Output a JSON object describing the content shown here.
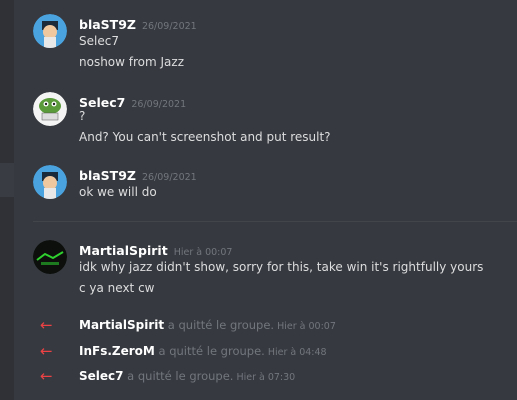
{
  "messages": [
    {
      "author": "blaST9Z",
      "timestamp": "26/09/2021",
      "lines": [
        "Selec7",
        "noshow from Jazz"
      ]
    },
    {
      "author": "Selec7",
      "timestamp": "26/09/2021",
      "lines": [
        "?",
        "And? You can't screenshot and put result?"
      ]
    },
    {
      "author": "blaST9Z",
      "timestamp": "26/09/2021",
      "lines": [
        "ok we will do"
      ]
    },
    {
      "author": "MartialSpirit",
      "timestamp": "Hier à 00:07",
      "lines": [
        "idk why jazz didn't show, sorry for this, take win it's rightfully yours",
        "c ya next cw"
      ]
    }
  ],
  "system": [
    {
      "user": "MartialSpirit",
      "action": "a quitté le groupe.",
      "time": "Hier à 00:07"
    },
    {
      "user": "InFs.ZeroM",
      "action": "a quitté le groupe.",
      "time": "Hier à 04:48"
    },
    {
      "user": "Selec7",
      "action": "a quitté le groupe.",
      "time": "Hier à 07:30"
    }
  ],
  "icons": {
    "leave": "left-arrow-icon"
  },
  "colors": {
    "background": "#36393f",
    "leave_arrow": "#ed4245",
    "author": "#ffffff",
    "timestamp": "#72767d"
  }
}
